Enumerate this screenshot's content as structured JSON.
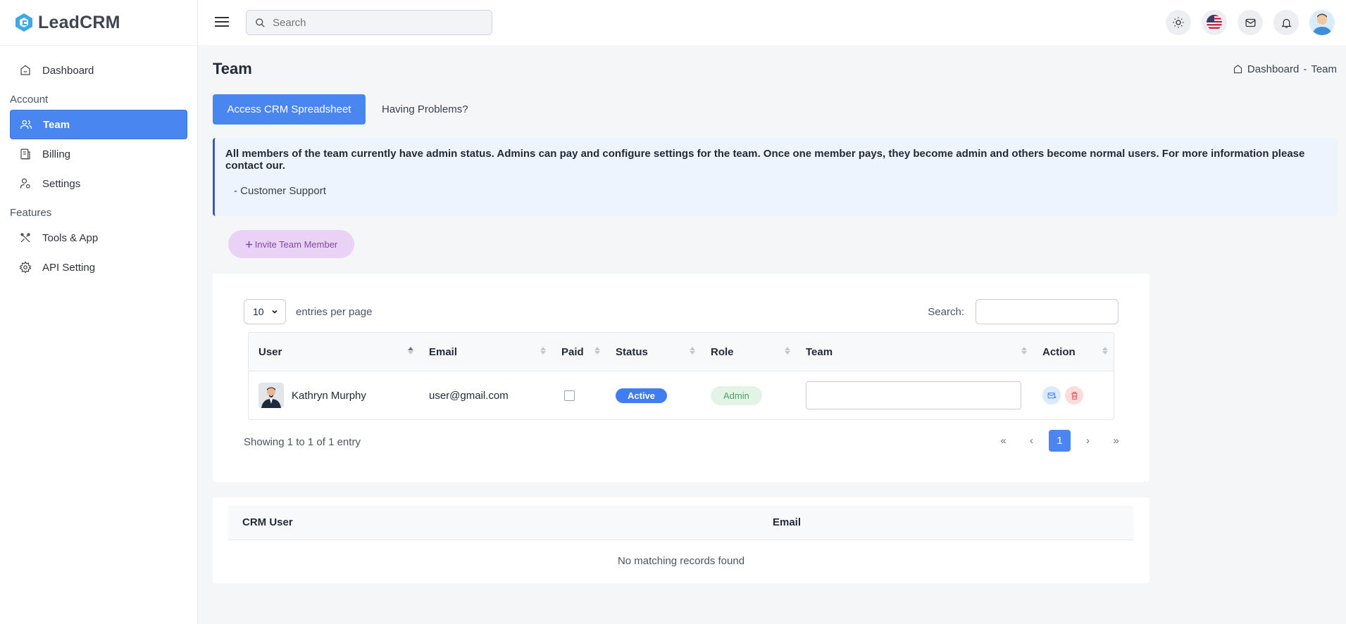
{
  "app": {
    "name": "LeadCRM"
  },
  "sidebar": {
    "items": [
      {
        "label": "Dashboard"
      },
      {
        "section": "Account"
      },
      {
        "label": "Team"
      },
      {
        "label": "Billing"
      },
      {
        "label": "Settings"
      },
      {
        "section": "Features"
      },
      {
        "label": "Tools & App"
      },
      {
        "label": "API Setting"
      }
    ]
  },
  "topbar": {
    "search_placeholder": "Search"
  },
  "page": {
    "title": "Team",
    "breadcrumb": {
      "home": "Dashboard",
      "separator": "-",
      "current": "Team"
    }
  },
  "actions": {
    "primary": "Access CRM Spreadsheet",
    "secondary": "Having Problems?"
  },
  "alert": {
    "text": "All members of the team currently have admin status. Admins can pay and configure settings for the team. Once one member pays, they become admin and others become normal users. For more information please contact our.",
    "signature": "- Customer Support"
  },
  "invite_button": "Invite Team Member",
  "members_table": {
    "page_size": "10",
    "entries_label": "entries per page",
    "search_label": "Search:",
    "columns": [
      "User",
      "Email",
      "Paid",
      "Status",
      "Role",
      "Team",
      "Action"
    ],
    "rows": [
      {
        "name": "Kathryn Murphy",
        "email": "user@gmail.com",
        "paid": false,
        "status": "Active",
        "role": "Admin"
      }
    ],
    "showing": "Showing 1 to 1 of 1 entry",
    "pagination": {
      "first": "«",
      "prev": "‹",
      "current": "1",
      "next": "›",
      "last": "»"
    }
  },
  "crm_table": {
    "columns": [
      "CRM User",
      "Email"
    ],
    "empty": "No matching records found"
  },
  "colors": {
    "accent": "#4a86f0",
    "invite_bg": "#ead2f6",
    "alert_bg": "#eef4fd",
    "success": "#4ca25f",
    "danger": "#e05656"
  }
}
